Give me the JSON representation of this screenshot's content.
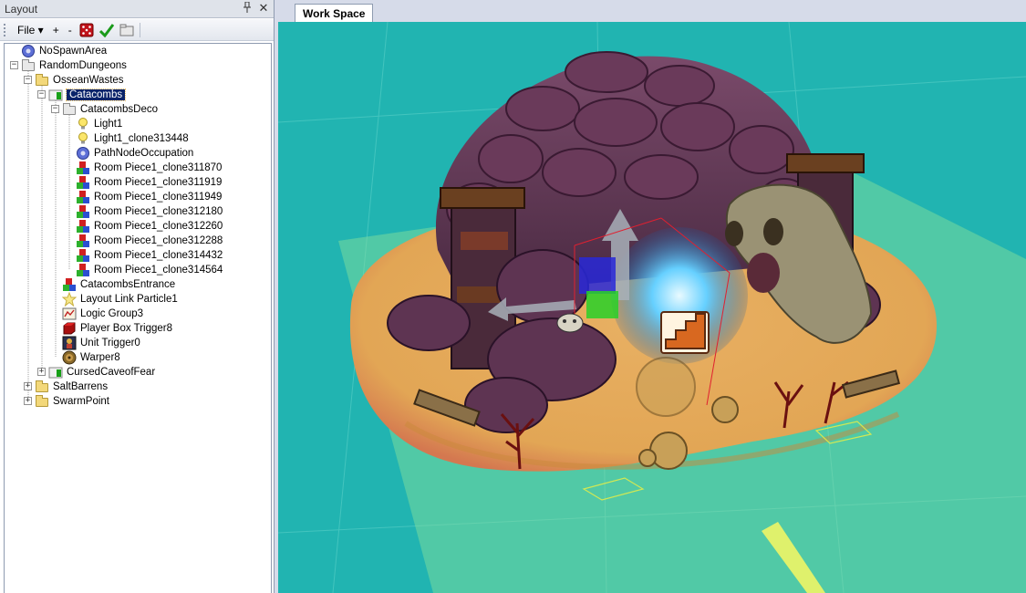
{
  "layout_panel": {
    "title": "Layout",
    "pin_icon": "pin-icon",
    "close_icon": "close-icon",
    "toolbar": {
      "file_label": "File ▾",
      "add_label": "+",
      "remove_label": "-"
    }
  },
  "tree": {
    "items": [
      {
        "label": "NoSpawnArea",
        "icon": "gear-icon"
      },
      {
        "label": "RandomDungeons",
        "icon": "folder-icon"
      },
      {
        "label": "OsseanWastes",
        "icon": "folder-icon"
      },
      {
        "label": "Catacombs",
        "icon": "level-icon",
        "selected": true
      },
      {
        "label": "CatacombsDeco",
        "icon": "folder-icon"
      },
      {
        "label": "Light1",
        "icon": "light-bulb-icon"
      },
      {
        "label": "Light1_clone313448",
        "icon": "light-bulb-icon"
      },
      {
        "label": "PathNodeOccupation",
        "icon": "gear-icon"
      },
      {
        "label": "Room Piece1_clone311870",
        "icon": "room-piece-icon"
      },
      {
        "label": "Room Piece1_clone311919",
        "icon": "room-piece-icon"
      },
      {
        "label": "Room Piece1_clone311949",
        "icon": "room-piece-icon"
      },
      {
        "label": "Room Piece1_clone312180",
        "icon": "room-piece-icon"
      },
      {
        "label": "Room Piece1_clone312260",
        "icon": "room-piece-icon"
      },
      {
        "label": "Room Piece1_clone312288",
        "icon": "room-piece-icon"
      },
      {
        "label": "Room Piece1_clone314432",
        "icon": "room-piece-icon"
      },
      {
        "label": "Room Piece1_clone314564",
        "icon": "room-piece-icon"
      },
      {
        "label": "CatacombsEntrance",
        "icon": "room-piece-icon"
      },
      {
        "label": "Layout Link Particle1",
        "icon": "particle-star-icon"
      },
      {
        "label": "Logic Group3",
        "icon": "logic-group-icon"
      },
      {
        "label": "Player Box Trigger8",
        "icon": "box-trigger-icon"
      },
      {
        "label": "Unit Trigger0",
        "icon": "unit-trigger-icon"
      },
      {
        "label": "Warper8",
        "icon": "warper-icon"
      },
      {
        "label": "CursedCaveofFear",
        "icon": "level-icon"
      },
      {
        "label": "SaltBarrens",
        "icon": "folder-icon"
      },
      {
        "label": "SwarmPoint",
        "icon": "folder-icon"
      }
    ]
  },
  "workspace": {
    "tab_label": "Work Space",
    "background_color": "#1fb3b0"
  }
}
